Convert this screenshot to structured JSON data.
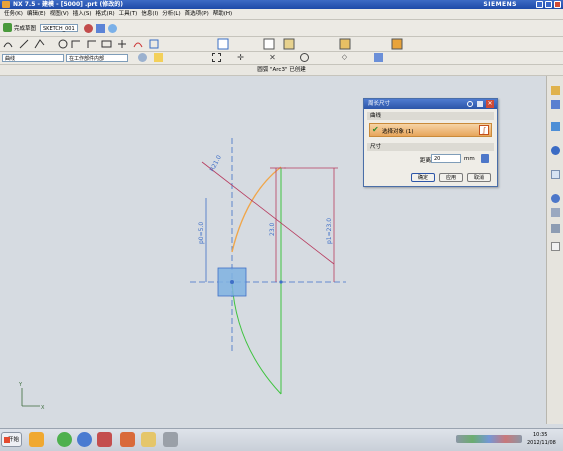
{
  "window": {
    "title": "NX 7.5 - 建模 - [5000] .prt  (修改的)",
    "brand": "SIEMENS"
  },
  "menu": [
    "任务(K)",
    "编辑(E)",
    "视图(V)",
    "插入(S)",
    "格式(R)",
    "工具(T)",
    "信息(I)",
    "分析(L)",
    "首选项(P)",
    "帮助(H)"
  ],
  "toolbar": {
    "finish_sketch": "完成草图",
    "sketch_name": "SKETCH_001",
    "filter_value": "曲线",
    "scope_value": "在工作部件内部"
  },
  "status_message": "圆弧 \"Arc3\" 已创建",
  "dialog": {
    "title": "周长尺寸",
    "section_curve": "曲线",
    "select_object": "选择对象 (1)",
    "section_dim": "尺寸",
    "distance_label": "距离",
    "distance_value": "20",
    "unit": "mm",
    "ok": "确定",
    "apply": "应用",
    "cancel": "取消"
  },
  "dimensions": {
    "radius": "R21.0",
    "p_left": "p0=5.0",
    "p_vertical": "23.0",
    "p_right": "p1=23.0"
  },
  "taskbar": {
    "start": "开始",
    "time": "10:35",
    "date": "2012/11/08"
  },
  "colors": {
    "arc": "#f0a64a",
    "green_line": "#3ec33e",
    "construction": "#3f6fc7",
    "dimension": "#b73b5e",
    "selection_box": "#7fb2e0"
  }
}
